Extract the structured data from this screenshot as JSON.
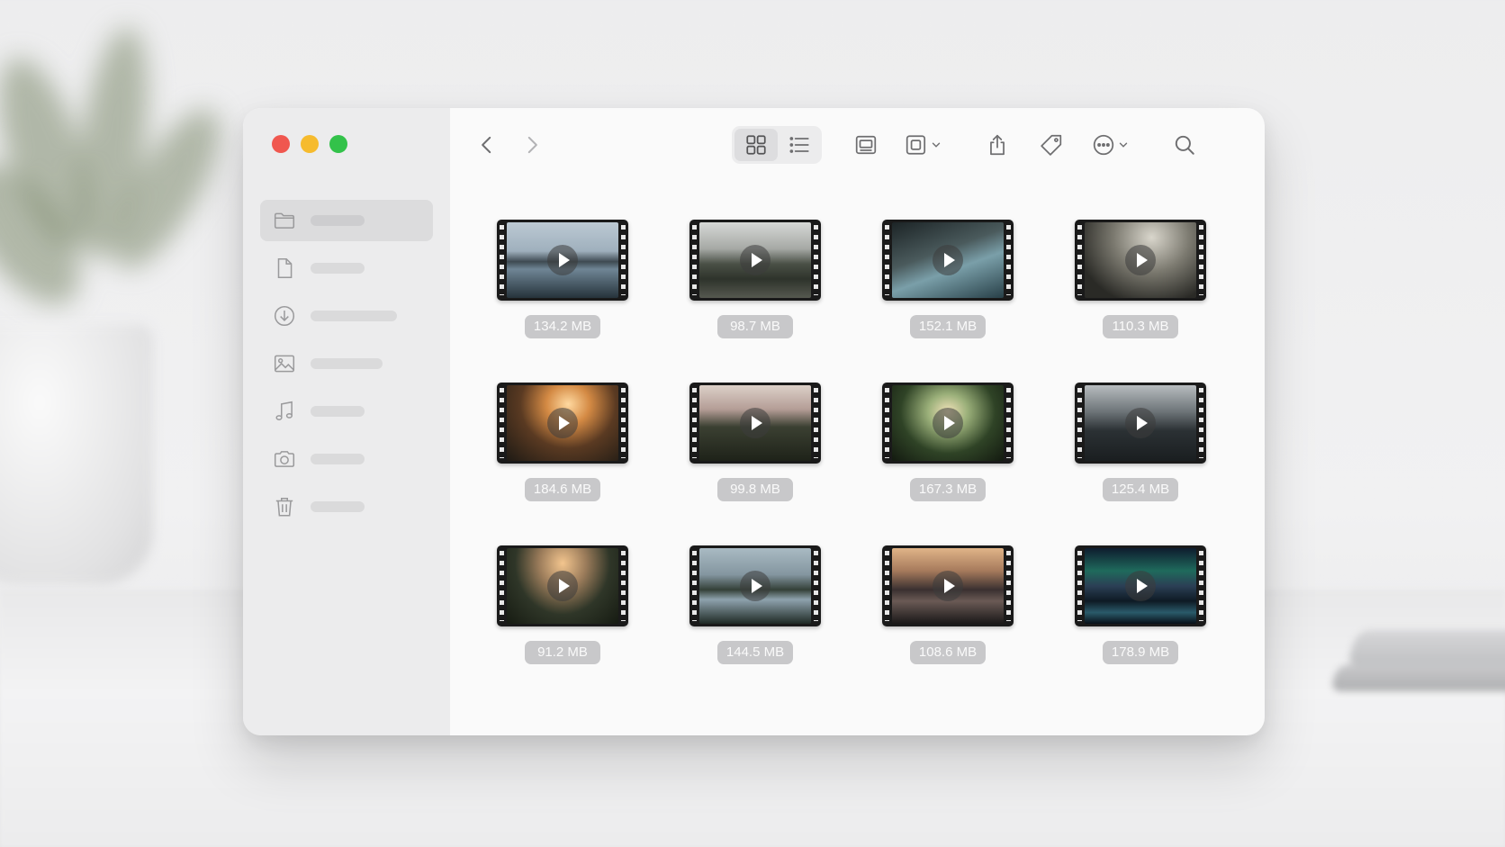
{
  "window": {
    "controls": [
      "close",
      "minimize",
      "zoom"
    ],
    "colors": {
      "close": "#f0574f",
      "minimize": "#f6bb2e",
      "zoom": "#33c24a",
      "sidebar_bg": "#ececed",
      "content_bg": "#fafafa"
    }
  },
  "sidebar": {
    "items": [
      {
        "icon": "folder-icon",
        "label": "",
        "active": true
      },
      {
        "icon": "document-icon",
        "label": "",
        "active": false
      },
      {
        "icon": "download-icon",
        "label": "",
        "active": false
      },
      {
        "icon": "photo-icon",
        "label": "",
        "active": false
      },
      {
        "icon": "music-icon",
        "label": "",
        "active": false
      },
      {
        "icon": "camera-icon",
        "label": "",
        "active": false
      },
      {
        "icon": "trash-icon",
        "label": "",
        "active": false
      }
    ]
  },
  "toolbar": {
    "icons": [
      "back-icon",
      "forward-icon",
      "grid-view-icon",
      "list-view-icon",
      "gallery-view-icon",
      "group-icon",
      "share-icon",
      "tag-icon",
      "more-icon",
      "search-icon"
    ],
    "active_view": "grid"
  },
  "files": [
    {
      "size": "134.2 MB",
      "scene": "mountain-lake"
    },
    {
      "size": "98.7 MB",
      "scene": "mountain-road"
    },
    {
      "size": "152.1 MB",
      "scene": "waterfall-lake"
    },
    {
      "size": "110.3 MB",
      "scene": "misty-river"
    },
    {
      "size": "184.6 MB",
      "scene": "sunset-valley"
    },
    {
      "size": "99.8 MB",
      "scene": "forest-road"
    },
    {
      "size": "167.3 MB",
      "scene": "forest-waterfall"
    },
    {
      "size": "125.4 MB",
      "scene": "dark-mountains"
    },
    {
      "size": "91.2 MB",
      "scene": "sunrise-forest"
    },
    {
      "size": "144.5 MB",
      "scene": "mountain-lake-valley"
    },
    {
      "size": "108.6 MB",
      "scene": "sunset-lake"
    },
    {
      "size": "178.9 MB",
      "scene": "aurora-lake"
    }
  ]
}
